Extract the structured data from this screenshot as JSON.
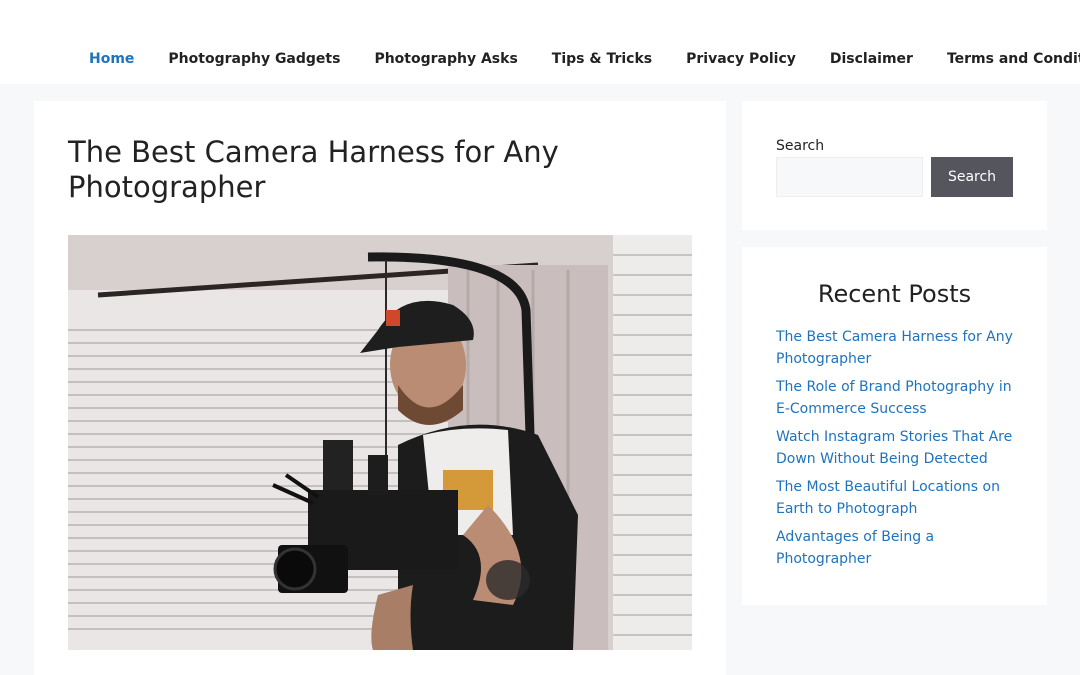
{
  "nav": {
    "items": [
      {
        "label": "Home",
        "active": true
      },
      {
        "label": "Photography Gadgets",
        "active": false
      },
      {
        "label": "Photography Asks",
        "active": false
      },
      {
        "label": "Tips & Tricks",
        "active": false
      },
      {
        "label": "Privacy Policy",
        "active": false
      },
      {
        "label": "Disclaimer",
        "active": false
      },
      {
        "label": "Terms and Conditions",
        "active": false
      }
    ]
  },
  "article": {
    "title": "The Best Camera Harness for Any Photographer"
  },
  "search": {
    "label": "Search",
    "value": "",
    "button_label": "Search"
  },
  "recent_posts": {
    "title": "Recent Posts",
    "items": [
      "The Best Camera Harness for Any Photographer",
      "The Role of Brand Photography in E-Commerce Success",
      "Watch Instagram Stories That Are Down Without Being Detected",
      "The Most Beautiful Locations on Earth to Photograph",
      "Advantages of Being a Photographer"
    ]
  },
  "colors": {
    "accent": "#1e73be",
    "button": "#55555e",
    "page_bg": "#f7f8f9"
  }
}
